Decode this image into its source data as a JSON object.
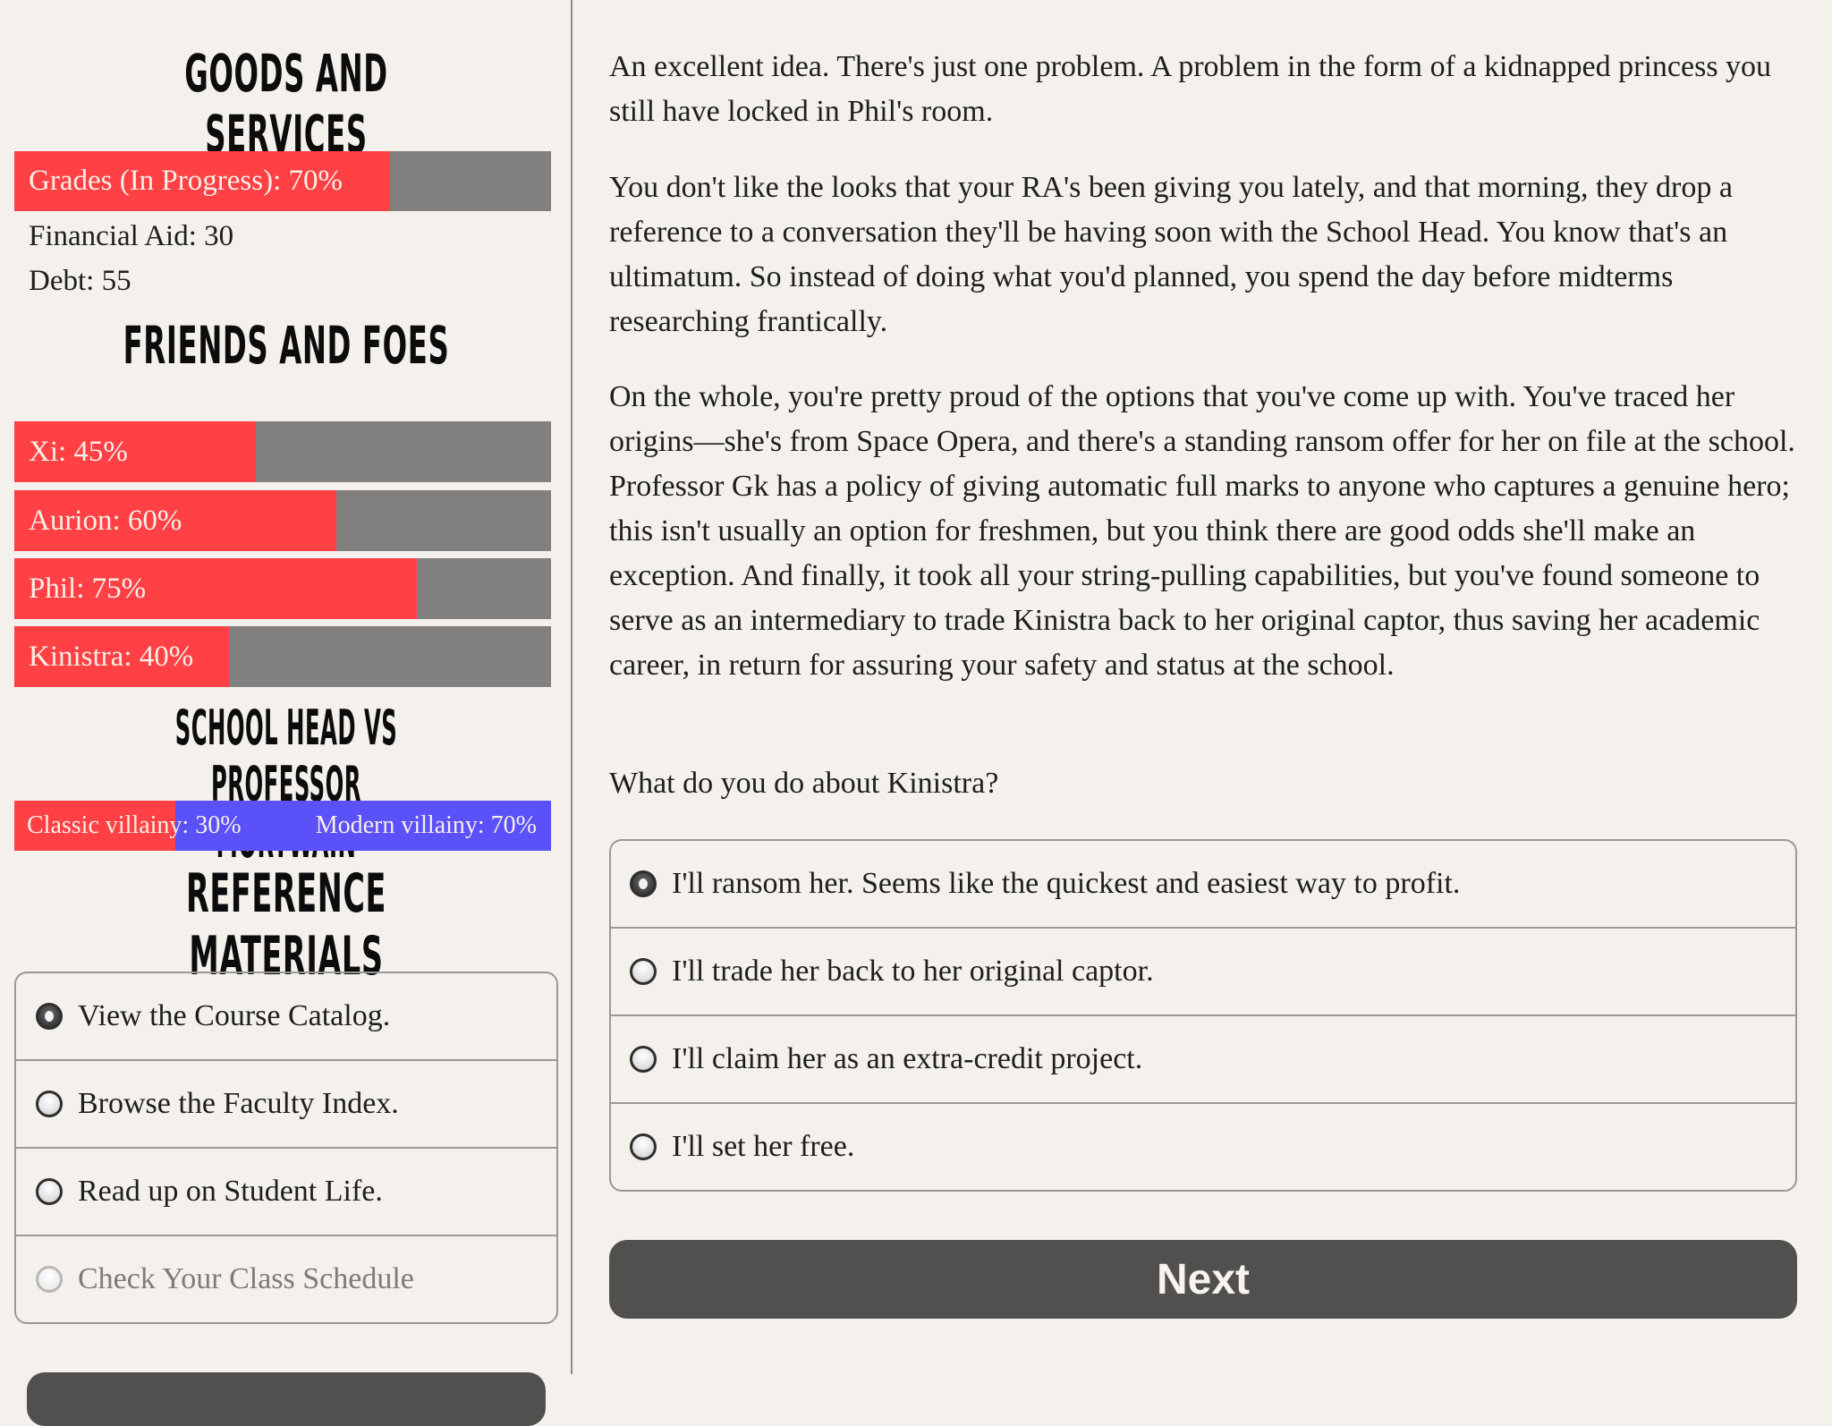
{
  "sidebar": {
    "goods_heading": "Goods and Services",
    "grades": {
      "label": "Grades (In Progress): 70%",
      "value": 70
    },
    "financial_aid": "Financial Aid: 30",
    "debt": "Debt: 55",
    "friends_heading": "Friends and Foes",
    "relationships": [
      {
        "label": "Xi: 45%",
        "value": 45
      },
      {
        "label": "Aurion: 60%",
        "value": 60
      },
      {
        "label": "Phil: 75%",
        "value": 75
      },
      {
        "label": "Kinistra: 40%",
        "value": 40
      }
    ],
    "rivalry_heading": "School Head vs Professor Mortwain",
    "rivalry": {
      "left_label": "Classic villainy: 30%",
      "right_label": "Modern villainy: 70%",
      "left_value": 30,
      "left_color": "#ff4146",
      "right_color": "#5a51f9"
    },
    "reference_heading": "Reference Materials",
    "reference_options": [
      {
        "label": "View the Course Catalog.",
        "checked": true,
        "disabled": false
      },
      {
        "label": "Browse the Faculty Index.",
        "checked": false,
        "disabled": false
      },
      {
        "label": "Read up on Student Life.",
        "checked": false,
        "disabled": false
      },
      {
        "label": "Check Your Class Schedule",
        "checked": false,
        "disabled": true
      }
    ]
  },
  "main": {
    "paragraphs": [
      "An excellent idea. There's just one problem. A problem in the form of a kidnapped princess you still have locked in Phil's room.",
      "You don't like the looks that your RA's been giving you lately, and that morning, they drop a reference to a conversation they'll be having soon with the School Head. You know that's an ultimatum. So instead of doing what you'd planned, you spend the day before midterms researching frantically.",
      "On the whole, you're pretty proud of the options that you've come up with. You've traced her origins—she's from Space Opera, and there's a standing ransom offer for her on file at the school. Professor Gk has a policy of giving automatic full marks to anyone who captures a genuine hero; this isn't usually an option for freshmen, but you think there are good odds she'll make an exception. And finally, it took all your string-pulling capabilities, but you've found someone to serve as an intermediary to trade Kinistra back to her original captor, thus saving her academic career, in return for assuring your safety and status at the school."
    ],
    "question": "What do you do about Kinistra?",
    "choices": [
      {
        "label": "I'll ransom her. Seems like the quickest and easiest way to profit.",
        "checked": true
      },
      {
        "label": "I'll trade her back to her original captor.",
        "checked": false
      },
      {
        "label": "I'll claim her as an extra-credit project.",
        "checked": false
      },
      {
        "label": "I'll set her free.",
        "checked": false
      }
    ],
    "next_label": "Next"
  },
  "colors": {
    "background": "#f4f1ec",
    "bar_fill": "#ff4146",
    "bar_track": "#82807e",
    "button": "#51504e"
  }
}
